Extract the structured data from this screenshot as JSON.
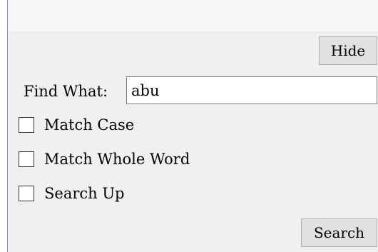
{
  "find_panel": {
    "hide_label": "Hide",
    "find_what_label": "Find What:",
    "find_what_value": "abu",
    "options": [
      {
        "label": "Match Case",
        "checked": false
      },
      {
        "label": "Match Whole Word",
        "checked": false
      },
      {
        "label": "Search Up",
        "checked": false
      }
    ],
    "search_label": "Search"
  },
  "colors": {
    "panel_background": "#f0f0f0",
    "button_background": "#e1e1e1",
    "button_border": "#adadad",
    "left_border": "#7a9cc6"
  }
}
